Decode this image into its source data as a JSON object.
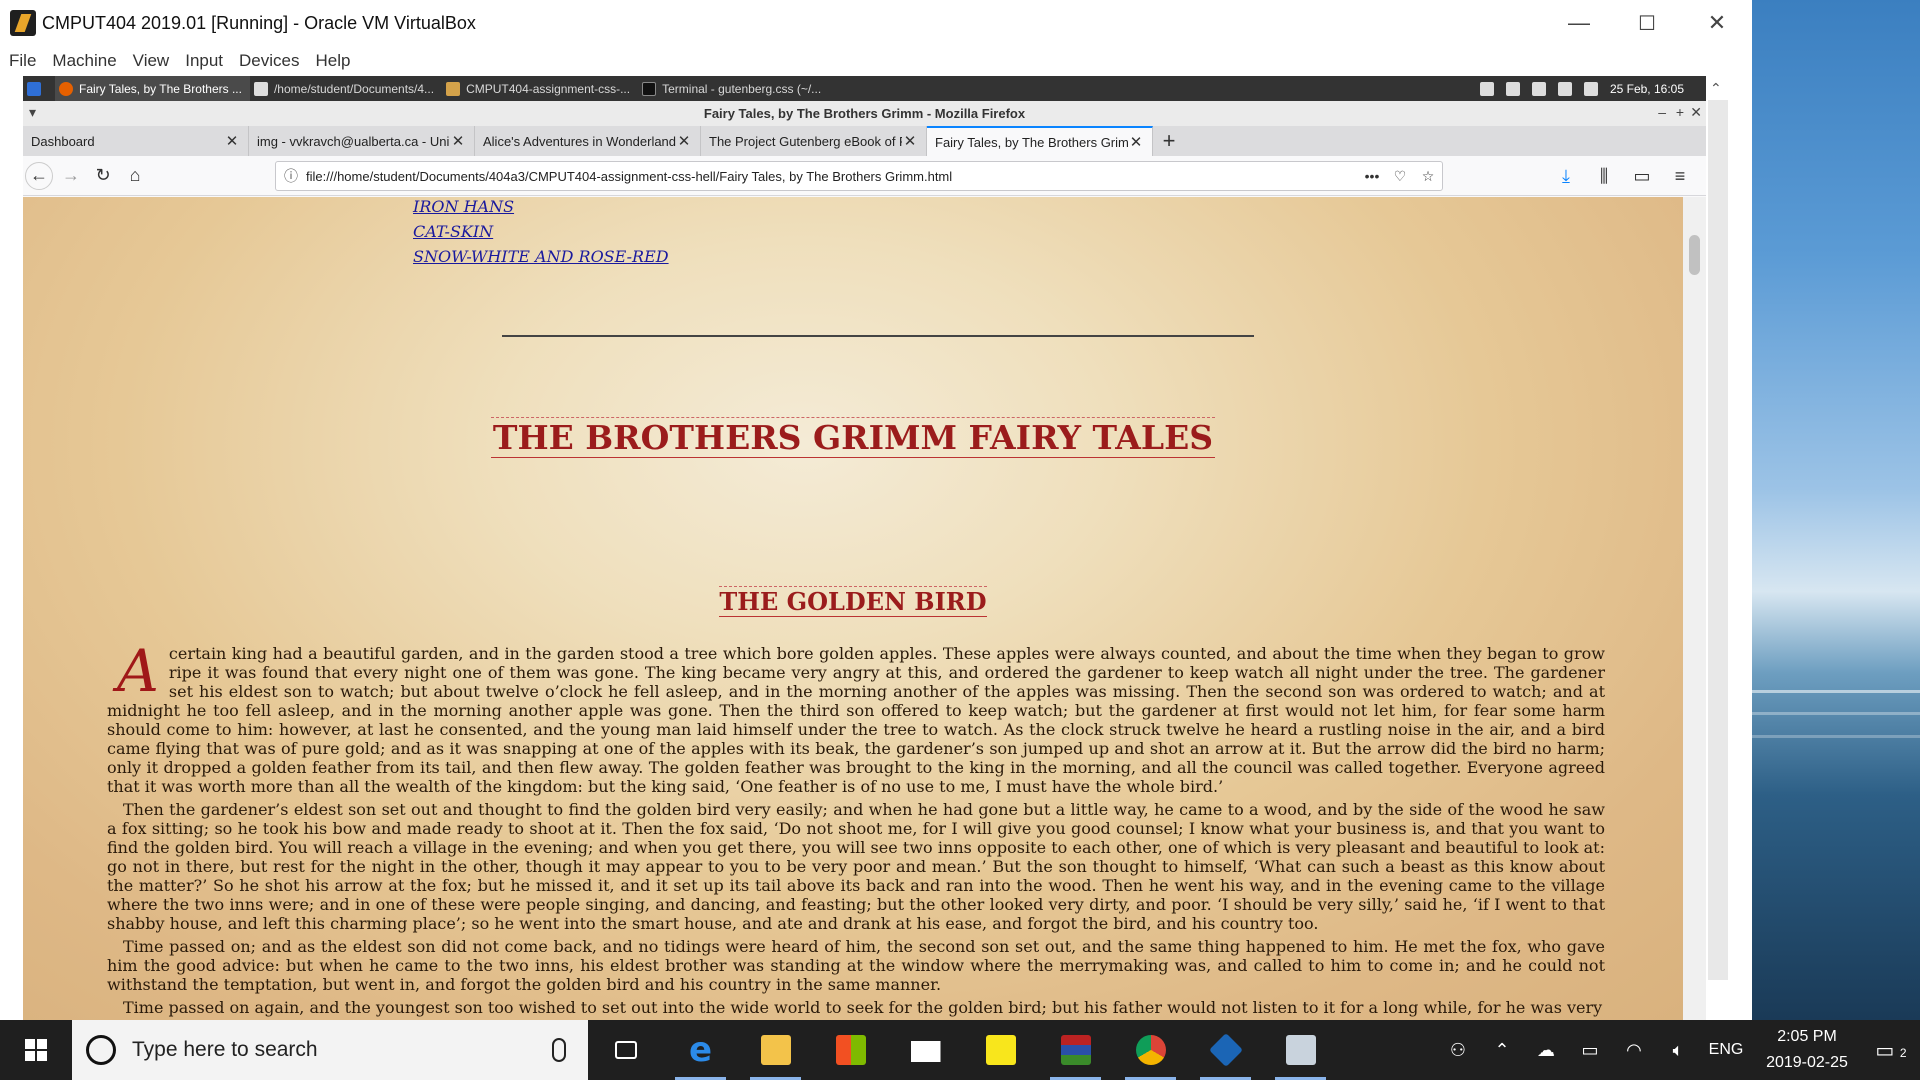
{
  "vbox": {
    "title": "CMPUT404 2019.01 [Running] - Oracle VM VirtualBox",
    "menu": [
      "File",
      "Machine",
      "View",
      "Input",
      "Devices",
      "Help"
    ],
    "minimize": "—",
    "maximize": "☐",
    "close": "✕"
  },
  "guest_taskbar": {
    "items": [
      {
        "label": "Fairy Tales, by The Brothers ...",
        "icon_color": "#e66000",
        "active": true
      },
      {
        "label": "/home/student/Documents/4...",
        "icon_color": "#dddddd",
        "active": false
      },
      {
        "label": "CMPUT404-assignment-css-...",
        "icon_color": "#d4a24a",
        "active": false
      },
      {
        "label": "Terminal - gutenberg.css (~/...",
        "icon_color": "#222222",
        "active": false
      }
    ],
    "clock": "25 Feb, 16:05"
  },
  "firefox": {
    "window_title": "Fairy Tales, by The Brothers Grimm - Mozilla Firefox",
    "tabs": [
      {
        "label": "Dashboard",
        "active": false
      },
      {
        "label": "img - vvkravch@ualberta.ca - Uni",
        "active": false
      },
      {
        "label": "Alice's Adventures in Wonderland",
        "active": false
      },
      {
        "label": "The Project Gutenberg eBook of F",
        "active": false
      },
      {
        "label": "Fairy Tales, by The Brothers Grimm",
        "active": true
      }
    ],
    "url": "file:///home/student/Documents/404a3/CMPUT404-assignment-css-hell/Fairy Tales, by The Brothers Grimm.html"
  },
  "page": {
    "toc_links": [
      "IRON HANS",
      "CAT-SKIN",
      "SNOW-WHITE AND ROSE-RED"
    ],
    "main_title": "THE BROTHERS GRIMM FAIRY TALES",
    "story_title": "THE GOLDEN BIRD",
    "dropcap": "A",
    "paragraphs": [
      "certain king had a beautiful garden, and in the garden stood a tree which bore golden apples. These apples were always counted, and about the time when they began to grow ripe it was found that every night one of them was gone. The king became very angry at this, and ordered the gardener to keep watch all night under the tree. The gardener set his eldest son to watch; but about twelve o’clock he fell asleep, and in the morning another of the apples was missing. Then the second son was ordered to watch; and at midnight he too fell asleep, and in the morning another apple was gone. Then the third son offered to keep watch; but the gardener at first would not let him, for fear some harm should come to him: however, at last he consented, and the young man laid himself under the tree to watch. As the clock struck twelve he heard a rustling noise in the air, and a bird came flying that was of pure gold; and as it was snapping at one of the apples with its beak, the gardener’s son jumped up and shot an arrow at it. But the arrow did the bird no harm; only it dropped a golden feather from its tail, and then flew away. The golden feather was brought to the king in the morning, and all the council was called together. Everyone agreed that it was worth more than all the wealth of the kingdom: but the king said, ‘One feather is of no use to me, I must have the whole bird.’",
      "Then the gardener’s eldest son set out and thought to find the golden bird very easily; and when he had gone but a little way, he came to a wood, and by the side of the wood he saw a fox sitting; so he took his bow and made ready to shoot at it. Then the fox said, ‘Do not shoot me, for I will give you good counsel; I know what your business is, and that you want to find the golden bird. You will reach a village in the evening; and when you get there, you will see two inns opposite to each other, one of which is very pleasant and beautiful to look at: go not in there, but rest for the night in the other, though it may appear to you to be very poor and mean.’ But the son thought to himself, ‘What can such a beast as this know about the matter?’ So he shot his arrow at the fox; but he missed it, and it set up its tail above its back and ran into the wood. Then he went his way, and in the evening came to the village where the two inns were; and in one of these were people singing, and dancing, and feasting; but the other looked very dirty, and poor. ‘I should be very silly,’ said he, ‘if I went to that shabby house, and left this charming place’; so he went into the smart house, and ate and drank at his ease, and forgot the bird, and his country too.",
      "Time passed on; and as the eldest son did not come back, and no tidings were heard of him, the second son set out, and the same thing happened to him. He met the fox, who gave him the good advice: but when he came to the two inns, his eldest brother was standing at the window where the merrymaking was, and called to him to come in; and he could not withstand the temptation, but went in, and forgot the golden bird and his country in the same manner.",
      "Time passed on again, and the youngest son too wished to set out into the wide world to seek for the golden bird; but his father would not listen to it for a long while, for he was very"
    ]
  },
  "windows_taskbar": {
    "search_placeholder": "Type here to search",
    "time": "2:05 PM",
    "date": "2019-02-25",
    "language": "ENG",
    "notification_count": "2"
  }
}
